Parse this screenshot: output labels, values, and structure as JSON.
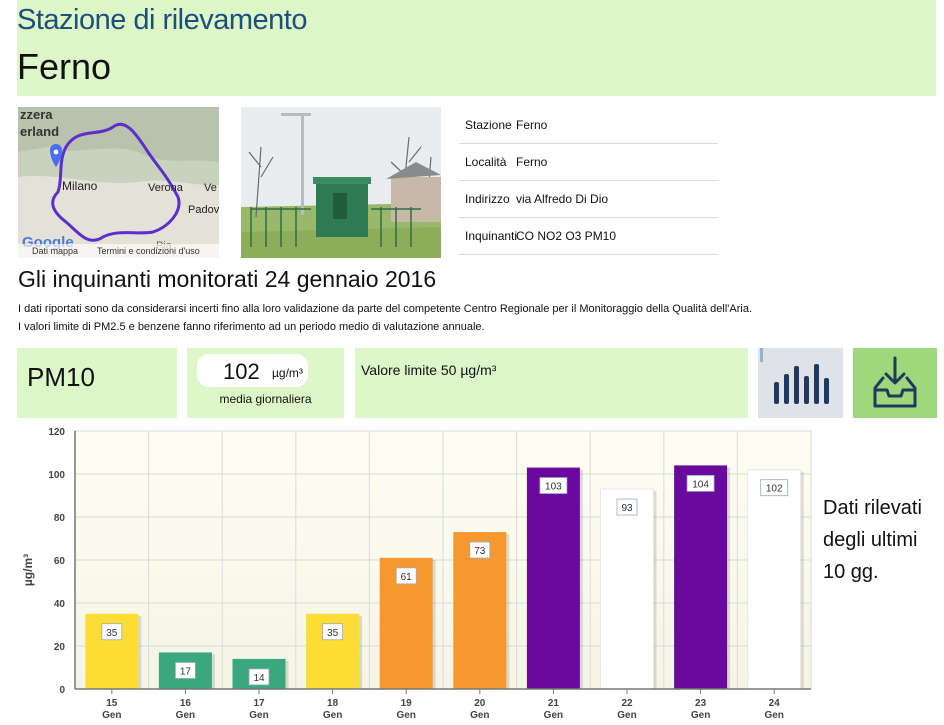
{
  "header": {
    "subtitle": "Stazione di rilevamento",
    "title": "Ferno"
  },
  "map": {
    "labels": [
      "zzera",
      "erland",
      "Milano",
      "Verona",
      "Ve",
      "Padov",
      "Pia"
    ],
    "footer": {
      "data": "Dati mappa",
      "terms": "Termini e condizioni d'uso",
      "logo": "Google"
    }
  },
  "info": [
    {
      "key": "Stazione",
      "value": "Ferno"
    },
    {
      "key": "Località",
      "value": "Ferno"
    },
    {
      "key": "Indirizzo",
      "value": "via Alfredo Di Dio"
    },
    {
      "key": "Inquinanti",
      "value": "CO NO2 O3 PM10"
    }
  ],
  "section_title": "Gli inquinanti monitorati 24 gennaio 2016",
  "notes": [
    "I dati riportati sono da considerarsi incerti fino alla loro validazione da parte del competente Centro Regionale per il Monitoraggio della Qualità dell'Aria.",
    "I valori limite di PM2.5 e benzene fanno riferimento ad un periodo medio di valutazione annuale."
  ],
  "pollutant": {
    "name": "PM10",
    "value": "102",
    "unit": "µg/m³",
    "caption": "media giornaliera",
    "limit": "Valore limite 50 µg/m³"
  },
  "buttons": {
    "chart_icon": "bar-chart-icon",
    "download_icon": "download-tray-icon"
  },
  "side_note": "Dati rilevati degli ultimi 10 gg.",
  "colors": {
    "panel": "#ddf7c8",
    "yellow": "#fbdd34",
    "green": "#3aa87f",
    "orange": "#f7982f",
    "purple": "#6a0a9c",
    "white": "#ffffff"
  },
  "chart_data": {
    "type": "bar",
    "ylabel": "µg/m³",
    "ylim": [
      0,
      120
    ],
    "yticks": [
      0,
      20,
      40,
      60,
      80,
      100,
      120
    ],
    "categories": [
      [
        "15",
        "Gen"
      ],
      [
        "16",
        "Gen"
      ],
      [
        "17",
        "Gen"
      ],
      [
        "18",
        "Gen"
      ],
      [
        "19",
        "Gen"
      ],
      [
        "20",
        "Gen"
      ],
      [
        "21",
        "Gen"
      ],
      [
        "22",
        "Gen"
      ],
      [
        "23",
        "Gen"
      ],
      [
        "24",
        "Gen"
      ]
    ],
    "values": [
      35,
      17,
      14,
      35,
      61,
      73,
      103,
      93,
      104,
      102
    ],
    "bar_colors": [
      "#fbdd34",
      "#3aa87f",
      "#3aa87f",
      "#fbdd34",
      "#f7982f",
      "#f7982f",
      "#6a0a9c",
      "#ffffff",
      "#6a0a9c",
      "#ffffff"
    ],
    "grid": true
  }
}
